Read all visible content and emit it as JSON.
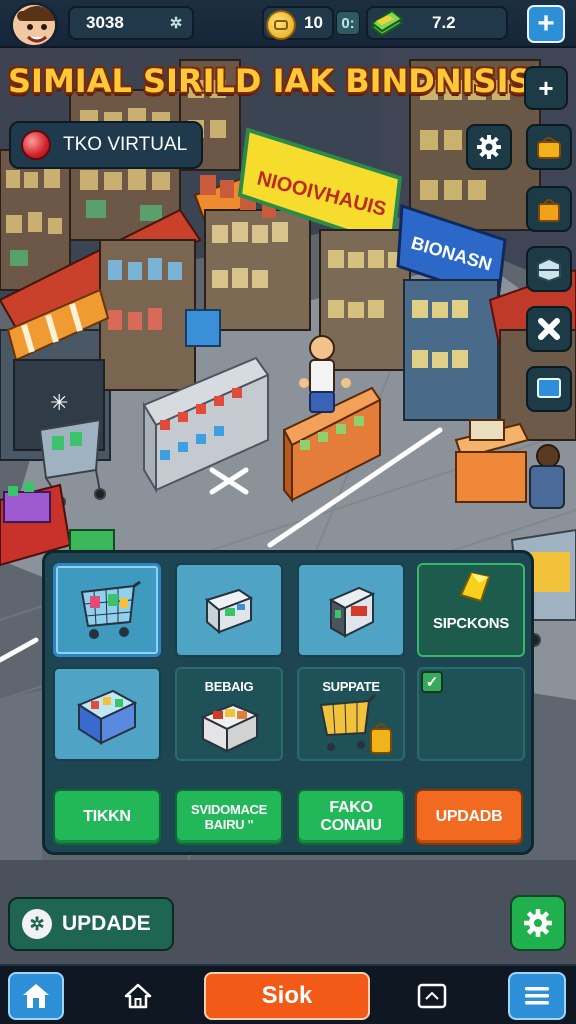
{
  "hud": {
    "player_id": "3038",
    "coins": "10",
    "coin_box_label": "0:",
    "cash": "7.2"
  },
  "title": "SIMIAL SIRILD IAK BINDNISIS",
  "location": {
    "label": "TKO VIRTUAL"
  },
  "scene": {
    "store_sign_left": "NIOOIVHAUIS",
    "store_sign_right": "BIONASN"
  },
  "panel": {
    "tiles": [
      {
        "label": ""
      },
      {
        "label": ""
      },
      {
        "label": ""
      },
      {
        "label": "SIPCKONS"
      },
      {
        "label": ""
      },
      {
        "label": "BEBAIG"
      },
      {
        "label": "SUPPATE"
      },
      {
        "label": ""
      }
    ],
    "actions": [
      {
        "line1": "TIKKN",
        "line2": ""
      },
      {
        "line1": "SVIDOMACE",
        "line2": "BAIRU \""
      },
      {
        "line1": "FAKO",
        "line2": "CONAIU"
      },
      {
        "line1": "UPDADB",
        "line2": ""
      }
    ]
  },
  "update_button": {
    "label": "UPDADE"
  },
  "nav": {
    "shop_label": "Siok"
  },
  "colors": {
    "title": "#ffc93a",
    "accent_blue": "#2d8fd8",
    "accent_green": "#22b85a",
    "accent_orange": "#f26a1f",
    "panel": "#1d4652"
  }
}
